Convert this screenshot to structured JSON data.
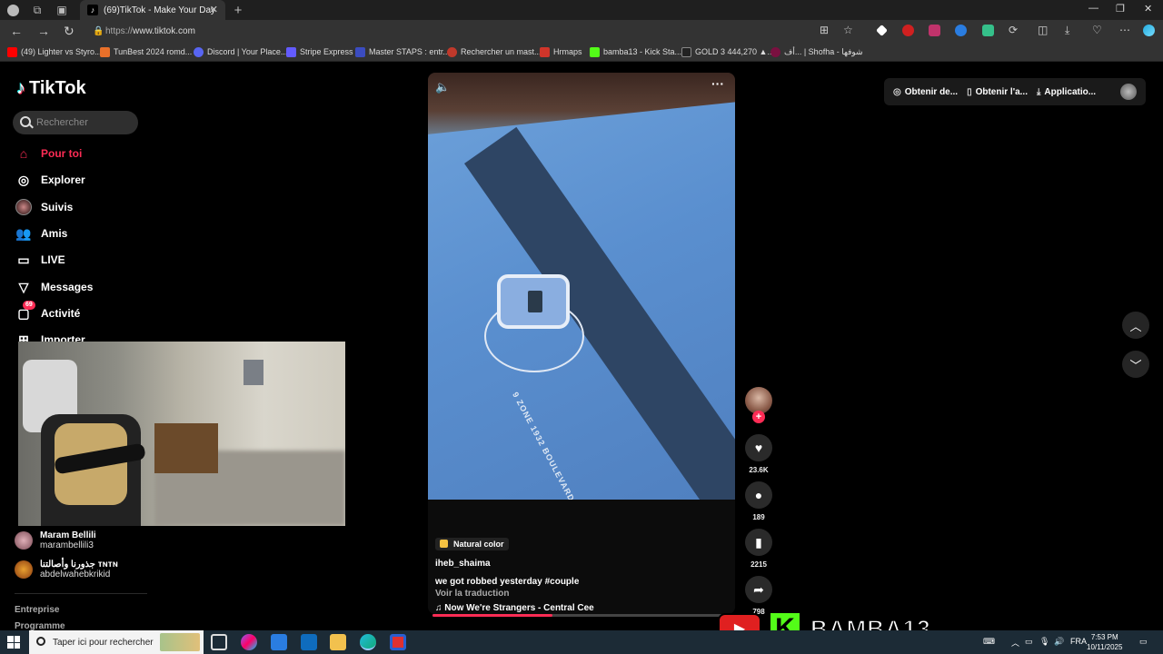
{
  "browser": {
    "tab_title": "(69)TikTok - Make Your Day",
    "url_prefix": "https://",
    "url_host": "www.tiktok.com",
    "bookmarks": [
      {
        "label": "(49) Lighter vs Styro...",
        "color": "#ff0000"
      },
      {
        "label": "TunBest 2024 romd...",
        "color": "#e8702a"
      },
      {
        "label": "Discord | Your Place...",
        "color": "#5865f2"
      },
      {
        "label": "Stripe Express",
        "color": "#635bff"
      },
      {
        "label": "Master STAPS : entr...",
        "color": "#3b4cc0"
      },
      {
        "label": "Rechercher un mast...",
        "color": "#c0392b"
      },
      {
        "label": "Hrmaps",
        "color": "#d0352a"
      },
      {
        "label": "bamba13 - Kick Sta...",
        "color": "#53fc18"
      },
      {
        "label": "GOLD 3 444,270 ▲...",
        "color": "#222222"
      },
      {
        "label": "أف... | Shofha - شوفها",
        "color": "#7a1040"
      }
    ]
  },
  "tiktok": {
    "logo_text": "TikTok",
    "search_placeholder": "Rechercher",
    "sidebar": [
      {
        "label": "Pour toi",
        "icon": "home-icon",
        "active": true
      },
      {
        "label": "Explorer",
        "icon": "compass-icon"
      },
      {
        "label": "Suivis",
        "icon": "following-avatar"
      },
      {
        "label": "Amis",
        "icon": "friends-icon"
      },
      {
        "label": "LIVE",
        "icon": "live-icon"
      },
      {
        "label": "Messages",
        "icon": "send-icon"
      },
      {
        "label": "Activité",
        "icon": "inbox-icon",
        "badge": "69"
      },
      {
        "label": "Importer",
        "icon": "plus-icon"
      }
    ],
    "following": [
      {
        "name": "Maram Bellili",
        "handle": "marambellili3"
      },
      {
        "name": "جذورنا وأصالتنا ᴛɴᴛɴ",
        "handle": "abdelwahebkrikid"
      }
    ],
    "footer": [
      "Entreprise",
      "Programme"
    ],
    "top_actions": [
      {
        "label": "Obtenir de...",
        "icon": "coin-icon"
      },
      {
        "label": "Obtenir l'a...",
        "icon": "phone-icon"
      },
      {
        "label": "Applicatio...",
        "icon": "download-icon"
      }
    ],
    "video": {
      "road_label": "9 ZONE 1932 BOULEVARD",
      "effect": "Natural color",
      "username": "iheb_shaima",
      "description": "we got robbed yesterday #couple",
      "translate": "Voir la traduction",
      "music": "♫ Now We're Strangers - Central Cee",
      "progress": 0.4
    },
    "actions": {
      "likes": "23.6K",
      "comments": "189",
      "saves": "2215",
      "shares": "798"
    }
  },
  "overlay": {
    "streamer": "BAMBA13"
  },
  "taskbar": {
    "search_placeholder": "Taper ici pour rechercher",
    "lang": "FRA",
    "time": "7:53 PM",
    "date": "10/11/2025"
  }
}
